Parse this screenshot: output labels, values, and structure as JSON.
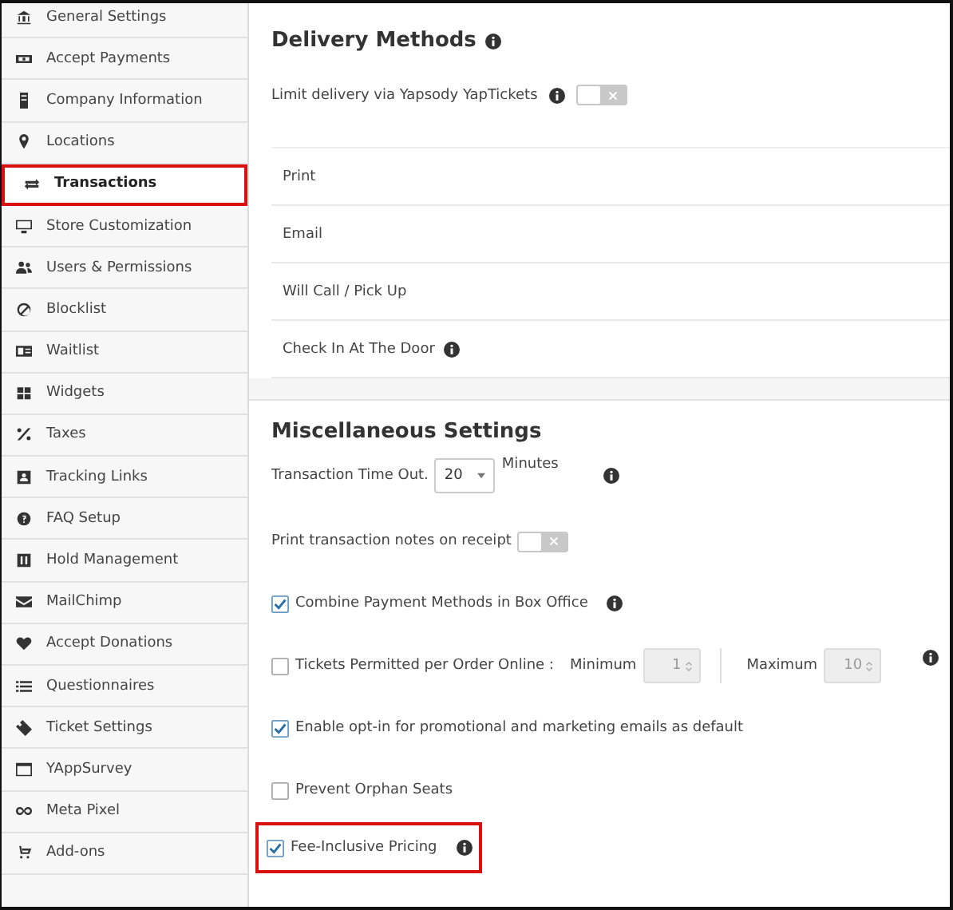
{
  "sidebar": {
    "items": [
      {
        "label": "General Settings",
        "selected": false
      },
      {
        "label": "Accept Payments",
        "selected": false
      },
      {
        "label": "Company Information",
        "selected": false
      },
      {
        "label": "Locations",
        "selected": false
      },
      {
        "label": "Transactions",
        "selected": true
      },
      {
        "label": "Store Customization",
        "selected": false
      },
      {
        "label": "Users & Permissions",
        "selected": false
      },
      {
        "label": "Blocklist",
        "selected": false
      },
      {
        "label": "Waitlist",
        "selected": false
      },
      {
        "label": "Widgets",
        "selected": false
      },
      {
        "label": "Taxes",
        "selected": false
      },
      {
        "label": "Tracking Links",
        "selected": false
      },
      {
        "label": "FAQ Setup",
        "selected": false
      },
      {
        "label": "Hold Management",
        "selected": false
      },
      {
        "label": "MailChimp",
        "selected": false
      },
      {
        "label": "Accept Donations",
        "selected": false
      },
      {
        "label": "Questionnaires",
        "selected": false
      },
      {
        "label": "Ticket Settings",
        "selected": false
      },
      {
        "label": "YAppSurvey",
        "selected": false
      },
      {
        "label": "Meta Pixel",
        "selected": false
      },
      {
        "label": "Add-ons",
        "selected": false
      }
    ]
  },
  "delivery": {
    "title": "Delivery Methods",
    "limit": {
      "label": "Limit delivery via Yapsody YapTickets",
      "on": false
    },
    "methods": [
      {
        "label": "Print",
        "info": false
      },
      {
        "label": "Email",
        "info": false
      },
      {
        "label": "Will Call / Pick Up",
        "info": false
      },
      {
        "label": "Check In At The Door",
        "info": true
      }
    ]
  },
  "misc": {
    "title": "Miscellaneous Settings",
    "items": [
      {
        "kind": "select",
        "label": "Transaction Time Out.",
        "value": "20",
        "unit": "Minutes",
        "info": true,
        "highlighted": false
      },
      {
        "kind": "toggle",
        "label": "Print transaction notes on receipt",
        "on": false,
        "info": false,
        "highlighted": false
      },
      {
        "kind": "checkbox",
        "label": "Combine Payment Methods in Box Office",
        "checked": true,
        "info": true,
        "highlighted": false
      },
      {
        "kind": "range",
        "label": "Tickets Permitted per Order Online :",
        "checked": false,
        "min_label": "Minimum",
        "min_value": "1",
        "max_label": "Maximum",
        "max_value": "10",
        "disabled": true,
        "info": true,
        "highlighted": false
      },
      {
        "kind": "checkbox",
        "label": "Enable opt-in for promotional and marketing emails as default",
        "checked": true,
        "info": false,
        "highlighted": false
      },
      {
        "kind": "checkbox",
        "label": "Prevent Orphan Seats",
        "checked": false,
        "info": false,
        "highlighted": false
      },
      {
        "kind": "checkbox",
        "label": "Fee-Inclusive Pricing",
        "checked": true,
        "info": true,
        "highlighted": true
      }
    ]
  }
}
